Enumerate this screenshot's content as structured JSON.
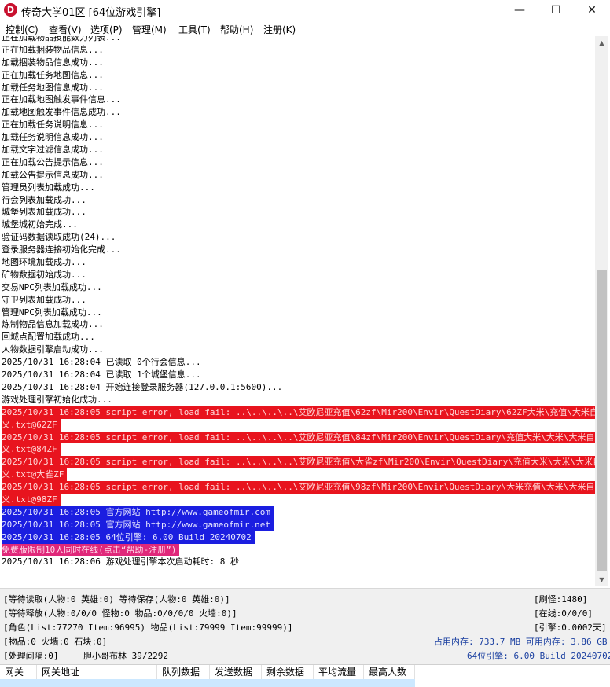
{
  "window": {
    "title": "传奇大学01区 [64位游戏引擎]",
    "app_icon_letter": "D",
    "minimize": "—",
    "maximize": "☐",
    "close": "✕"
  },
  "menu": [
    "控制(C)",
    "查看(V)",
    "选项(P)",
    "管理(M)",
    "工具(T)",
    "帮助(H)",
    "注册(K)"
  ],
  "log": [
    {
      "text": "正在加载物品技能数力列表...",
      "style": ""
    },
    {
      "text": "正在加载捆装物品信息...",
      "style": ""
    },
    {
      "text": "加载捆装物品信息成功...",
      "style": ""
    },
    {
      "text": "正在加载任务地图信息...",
      "style": ""
    },
    {
      "text": "加载任务地图信息成功...",
      "style": ""
    },
    {
      "text": "正在加载地图触发事件信息...",
      "style": ""
    },
    {
      "text": "加载地图触发事件信息成功...",
      "style": ""
    },
    {
      "text": "正在加载任务说明信息...",
      "style": ""
    },
    {
      "text": "加载任务说明信息成功...",
      "style": ""
    },
    {
      "text": "加载文字过滤信息成功...",
      "style": ""
    },
    {
      "text": "正在加载公告提示信息...",
      "style": ""
    },
    {
      "text": "加载公告提示信息成功...",
      "style": ""
    },
    {
      "text": "管理员列表加载成功...",
      "style": ""
    },
    {
      "text": "行会列表加载成功...",
      "style": ""
    },
    {
      "text": "城堡列表加载成功...",
      "style": ""
    },
    {
      "text": "城堡城初始完成...",
      "style": ""
    },
    {
      "text": "验证码数据读取成功(24)...",
      "style": ""
    },
    {
      "text": "登录服务器连接初始化完成...",
      "style": ""
    },
    {
      "text": "地图环境加载成功...",
      "style": ""
    },
    {
      "text": "矿物数据初始成功...",
      "style": ""
    },
    {
      "text": "交易NPC列表加载成功...",
      "style": ""
    },
    {
      "text": "守卫列表加载成功...",
      "style": ""
    },
    {
      "text": "管理NPC列表加载成功...",
      "style": ""
    },
    {
      "text": "炼制物品信息加载成功...",
      "style": ""
    },
    {
      "text": "回城点配置加载成功...",
      "style": ""
    },
    {
      "text": "人物数据引擎启动成功...",
      "style": ""
    },
    {
      "text": "2025/10/31 16:28:04 已读取 0个行会信息...",
      "style": ""
    },
    {
      "text": "2025/10/31 16:28:04 已读取 1个城堡信息...",
      "style": ""
    },
    {
      "text": "2025/10/31 16:28:04 开始连接登录服务器(127.0.0.1:5600)...",
      "style": ""
    },
    {
      "text": "游戏处理引擎初始化成功...",
      "style": ""
    },
    {
      "text": "2025/10/31 16:28:05 script error, load fail: ..\\..\\..\\..\\艾欧尼亚充值\\62zf\\Mir200\\Envir\\QuestDiary\\62ZF大米\\充值\\大米自定",
      "style": "red"
    },
    {
      "text": "义.txt@62ZF",
      "style": "red"
    },
    {
      "text": "2025/10/31 16:28:05 script error, load fail: ..\\..\\..\\..\\艾欧尼亚充值\\84zf\\Mir200\\Envir\\QuestDiary\\充值大米\\大米\\大米自定",
      "style": "red"
    },
    {
      "text": "义.txt@84ZF",
      "style": "red"
    },
    {
      "text": "2025/10/31 16:28:05 script error, load fail: ..\\..\\..\\..\\艾欧尼亚充值\\大雀zf\\Mir200\\Envir\\QuestDiary\\充值大米\\大米\\大米自定",
      "style": "red"
    },
    {
      "text": "义.txt@大雀ZF",
      "style": "red"
    },
    {
      "text": "2025/10/31 16:28:05 script error, load fail: ..\\..\\..\\..\\艾欧尼亚充值\\98zf\\Mir200\\Envir\\QuestDiary\\大米充值\\大米\\大米自定",
      "style": "red"
    },
    {
      "text": "义.txt@98ZF",
      "style": "red"
    },
    {
      "text": "2025/10/31 16:28:05 官方网站 http://www.gameofmir.com",
      "style": "blue"
    },
    {
      "text": "2025/10/31 16:28:05 官方网站 http://www.gameofmir.net",
      "style": "blue"
    },
    {
      "text": "2025/10/31 16:28:05 64位引擎: 6.00 Build 20240702",
      "style": "blue"
    },
    {
      "text": "免费版限制10人同时在线(点击“帮助-注册”)",
      "style": "pink"
    },
    {
      "text": "2025/10/31 16:28:06 游戏处理引擎本次启动耗时: 8 秒",
      "style": ""
    }
  ],
  "status": {
    "row1_left": "[等待读取(人物:0 英雄:0) 等待保存(人物:0 英雄:0)]",
    "row1_right": "[刷怪:1480]",
    "row2_left": "[等待释放(人物:0/0/0 怪物:0 物品:0/0/0/0 火墙:0)]",
    "row2_right": "[在线:0/0/0]",
    "row3_left": "[角色(List:77270 Item:96995) 物品(List:79999 Item:99999)]",
    "row3_right": "[引擎:0.0002天]",
    "row4_left": "[物品:0 火墙:0 石块:0]",
    "row4_right": "占用内存: 733.7 MB 可用内存: 3.86 GB",
    "row5_left": "[处理间隔:0]",
    "row5_mid": "胆小哥布林 39/2292",
    "row5_right": "64位引擎: 6.00 Build 20240702"
  },
  "table": {
    "columns": [
      "网关",
      "网关地址",
      "队列数据",
      "发送数据",
      "剩余数据",
      "平均流量",
      "最高人数"
    ]
  },
  "colors": {
    "error_bg": "#e8141e",
    "info_bg": "#1b1ee0",
    "notice_bg": "#e0287a",
    "memory_text": "#1a3fa0"
  }
}
